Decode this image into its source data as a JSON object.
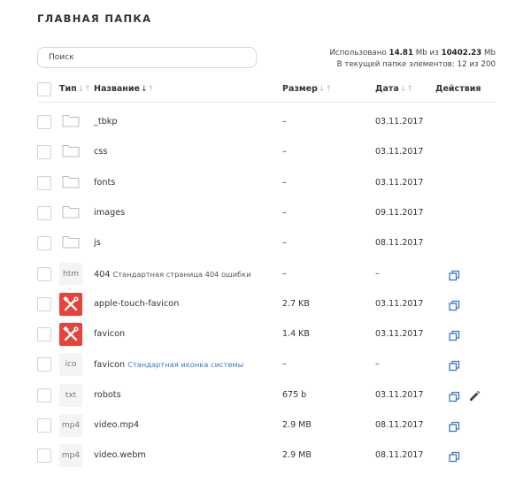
{
  "title": "ГЛАВНАЯ ПАПКА",
  "search": {
    "placeholder": "Поиск"
  },
  "usage": {
    "used_prefix": "Использовано",
    "used_value": "14.81",
    "used_unit": "Mb из",
    "total_value": "10402.23",
    "total_unit": "Mb",
    "items_line": "В текущей папке элементов: 12 из 200"
  },
  "columns": {
    "type": "Тип",
    "name": "Название",
    "size": "Размер",
    "date": "Дата",
    "actions": "Действия"
  },
  "sort_icons": {
    "idle": "↓↑",
    "active": "↓",
    "active_tail": "↑"
  },
  "rows": [
    {
      "icon": "folder-icon",
      "name": "_tbkp",
      "desc": "",
      "size": "–",
      "date": "03.11.2017"
    },
    {
      "icon": "folder-icon",
      "name": "css",
      "desc": "",
      "size": "–",
      "date": "03.11.2017"
    },
    {
      "icon": "folder-icon",
      "name": "fonts",
      "desc": "",
      "size": "–",
      "date": "03.11.2017"
    },
    {
      "icon": "folder-icon",
      "name": "images",
      "desc": "",
      "size": "–",
      "date": "09.11.2017"
    },
    {
      "icon": "folder-icon",
      "name": "js",
      "desc": "",
      "size": "–",
      "date": "08.11.2017"
    },
    {
      "ext": "htm",
      "name": "404",
      "desc": "Стандартная страница 404 ошибки",
      "size": "–",
      "date": "–"
    },
    {
      "icon": "tools-image-icon",
      "name": "apple-touch-favicon",
      "desc": "",
      "size": "2.7 KB",
      "date": "03.11.2017"
    },
    {
      "icon": "tools-image-icon",
      "name": "favicon",
      "desc": "",
      "size": "1.4 KB",
      "date": "03.11.2017"
    },
    {
      "ext": "ico",
      "name": "favicon",
      "desc": "Стандартная иконка системы",
      "size": "–",
      "date": "–"
    },
    {
      "ext": "txt",
      "name": "robots",
      "desc": "",
      "size": "675 b",
      "date": "03.11.2017"
    },
    {
      "ext": "mp4",
      "name": "video.mp4",
      "desc": "",
      "size": "2.9 MB",
      "date": "08.11.2017"
    },
    {
      "ext": "mp4",
      "name": "video.webm",
      "desc": "",
      "size": "2.9 MB",
      "date": "08.11.2017"
    }
  ],
  "colors": {
    "accent": "#3a78c2",
    "image_icon_bg": "#e8433a",
    "folder_stroke": "#b8bcc1"
  }
}
